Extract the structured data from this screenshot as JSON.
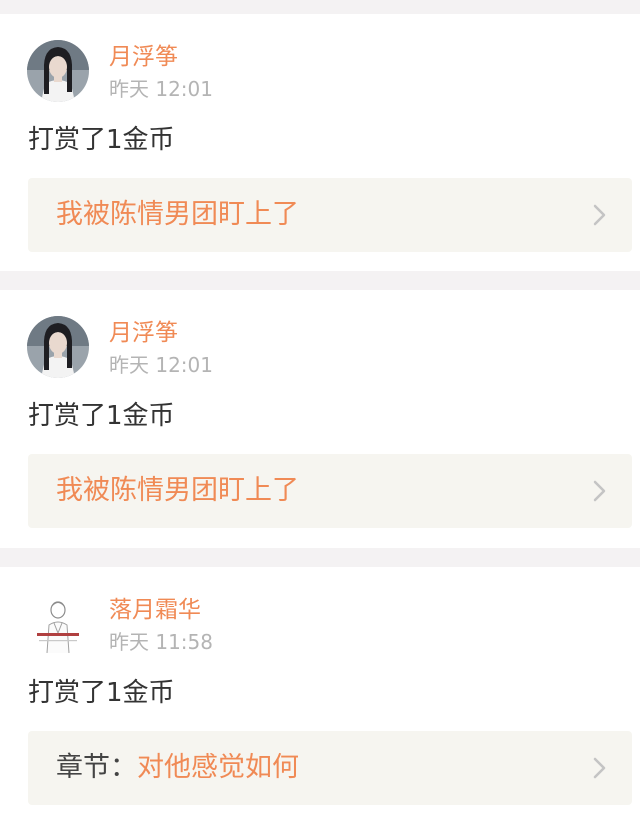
{
  "feed": {
    "items": [
      {
        "user": "月浮筝",
        "time": "昨天 12:01",
        "action": "打赏了1金币",
        "link_prefix": "",
        "link_title": "我被陈情男团盯上了",
        "avatar": "dark-haired-person-avatar"
      },
      {
        "user": "月浮筝",
        "time": "昨天 12:01",
        "action": "打赏了1金币",
        "link_prefix": "",
        "link_title": "我被陈情男团盯上了",
        "avatar": "dark-haired-person-avatar"
      },
      {
        "user": "落月霜华",
        "time": "昨天 11:58",
        "action": "打赏了1金币",
        "link_prefix": "章节：",
        "link_title": "对他感觉如何",
        "avatar": "sketch-figure-avatar"
      }
    ]
  },
  "colors": {
    "accent": "#f08a55",
    "background": "#f4f2f3",
    "card": "#ffffff",
    "link_box": "#f6f5f0",
    "timestamp": "#b4b4b4",
    "body_text": "#333333"
  },
  "icons": {
    "chevron": "chevron-right-icon"
  }
}
